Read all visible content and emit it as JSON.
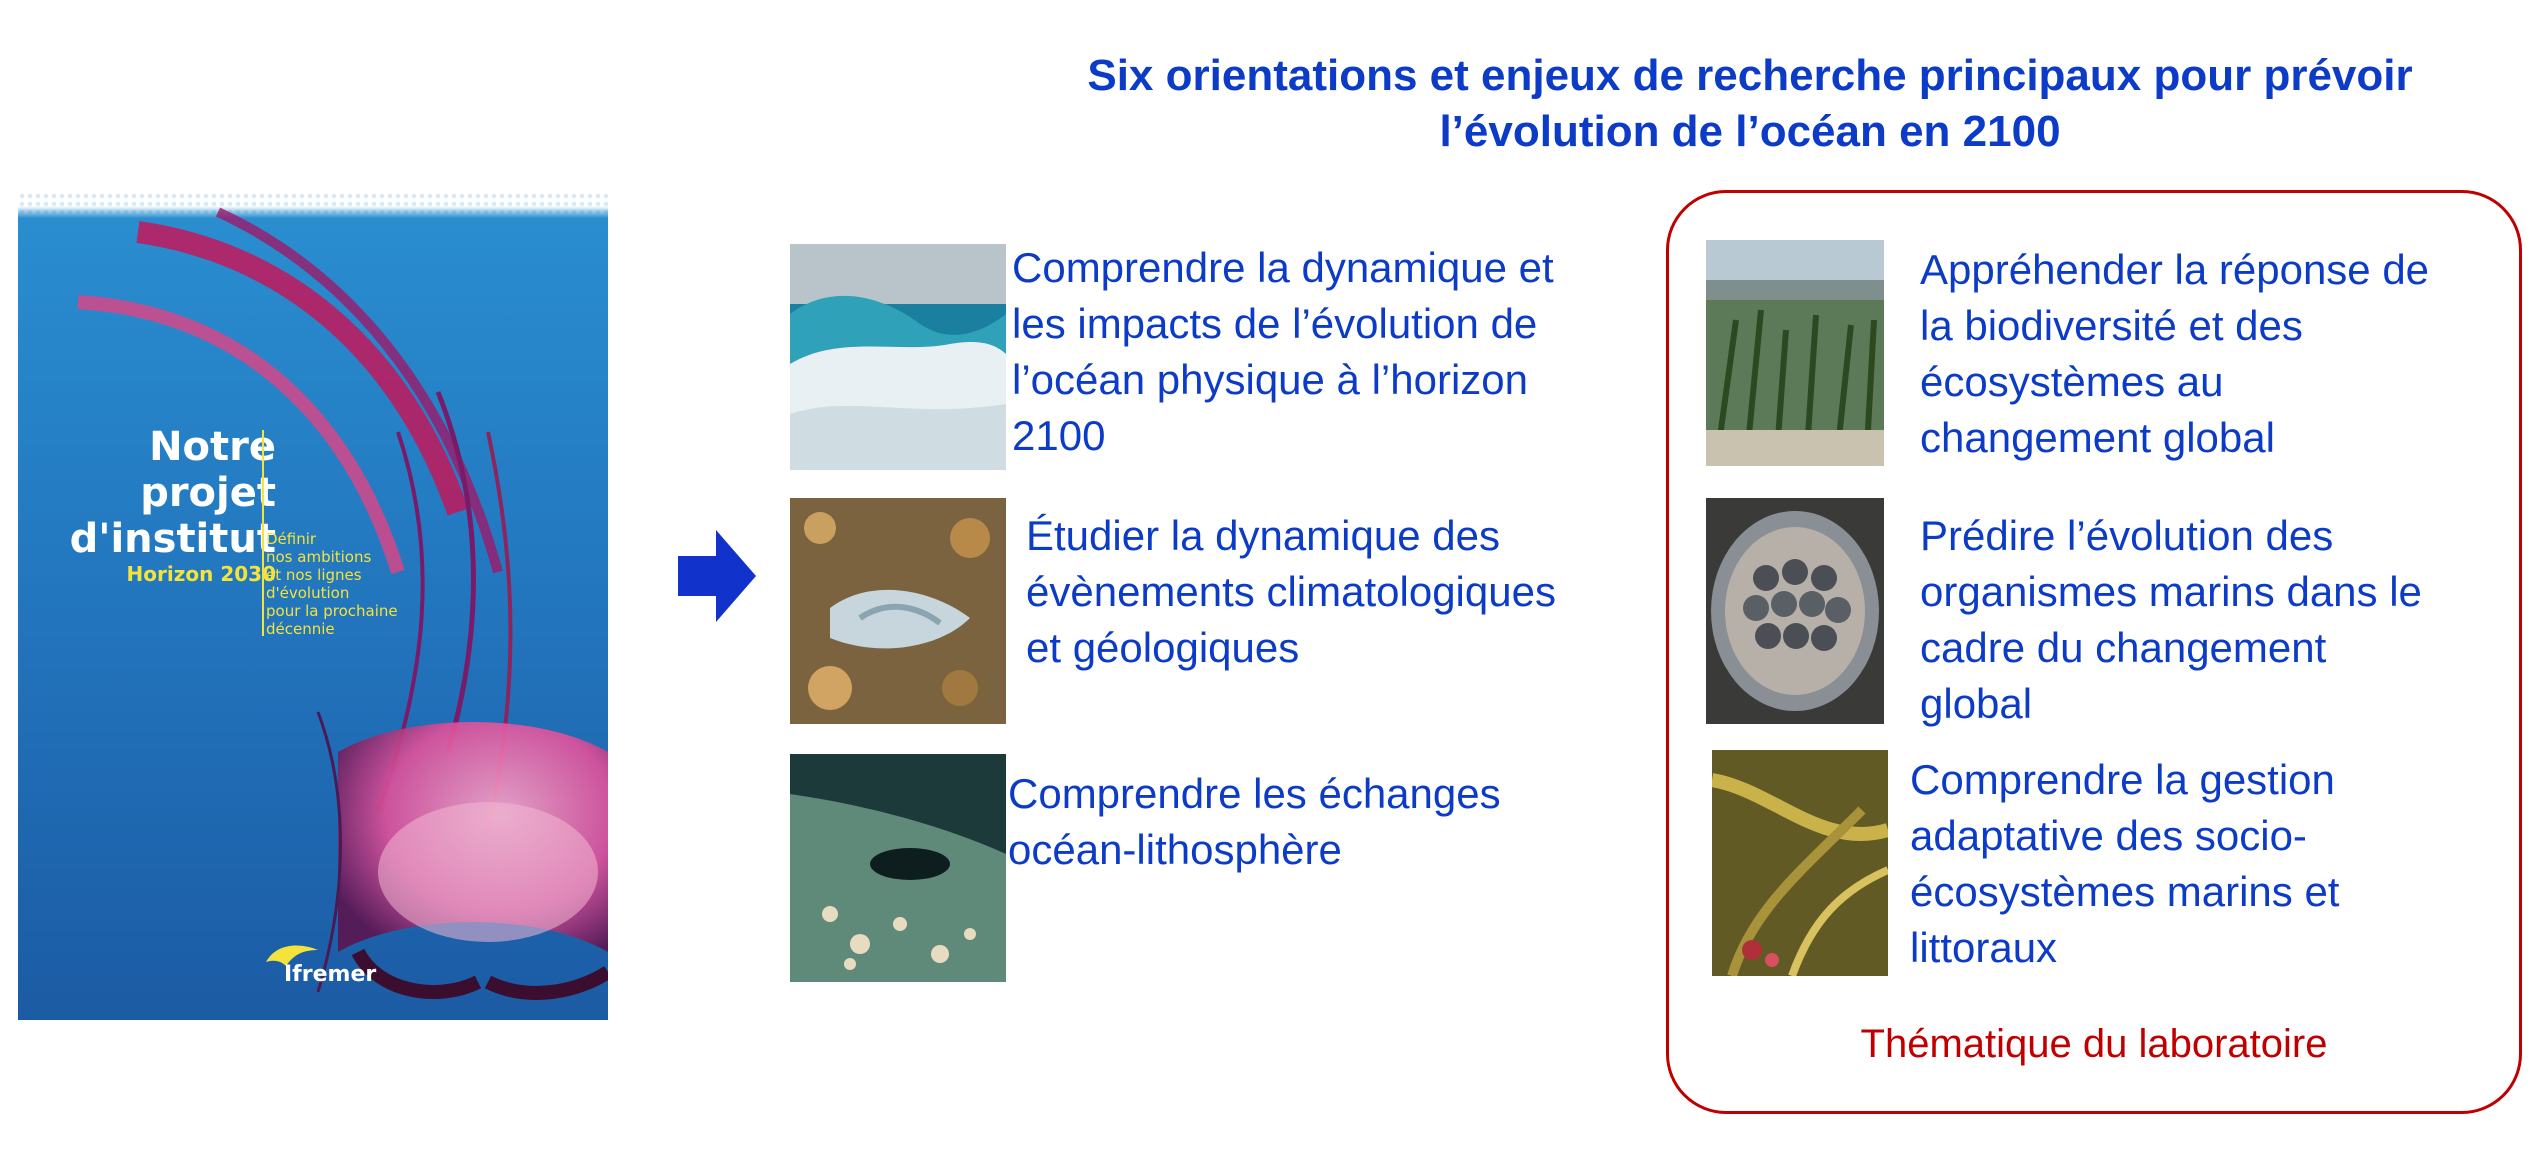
{
  "title": {
    "line1": "Six orientations et enjeux de recherche principaux pour prévoir",
    "line2": "l’évolution de l’océan en 2100"
  },
  "cover": {
    "title_lines": [
      "Notre",
      "projet",
      "d'institut"
    ],
    "horizon": "Horizon 2030",
    "description_lines": [
      "Définir",
      "nos ambitions",
      "et nos lignes",
      "d'évolution",
      "pour la prochaine",
      "décennie"
    ],
    "logo": "Ifremer"
  },
  "left_items": [
    {
      "lines": [
        "Comprendre la dynamique et",
        "les impacts de l’évolution de",
        "l’océan physique à l’horizon",
        "2100"
      ],
      "image": "ocean-waves-photo"
    },
    {
      "lines": [
        "Étudier la dynamique des",
        "évènements climatologiques",
        "et géologiques"
      ],
      "image": "seabed-debris-photo"
    },
    {
      "lines": [
        "Comprendre les échanges",
        "océan-lithosphère"
      ],
      "image": "deep-sea-floor-photo"
    }
  ],
  "right_items": [
    {
      "lines": [
        "Appréhender la réponse de",
        "la biodiversité et des",
        "écosystèmes au",
        "changement global"
      ],
      "image": "seagrass-photo"
    },
    {
      "lines": [
        "Prédire l’évolution des",
        "organismes marins dans le",
        "cadre du changement",
        "global"
      ],
      "image": "pearls-in-oyster-photo"
    },
    {
      "lines": [
        "Comprendre la gestion",
        "adaptative des socio-",
        "écosystèmes marins et",
        "littoraux"
      ],
      "image": "kelp-underwater-photo"
    }
  ],
  "lab_label": "Thématique du laboratoire",
  "colors": {
    "accent_blue": "#0b3bc7",
    "lab_red": "#c00000"
  }
}
